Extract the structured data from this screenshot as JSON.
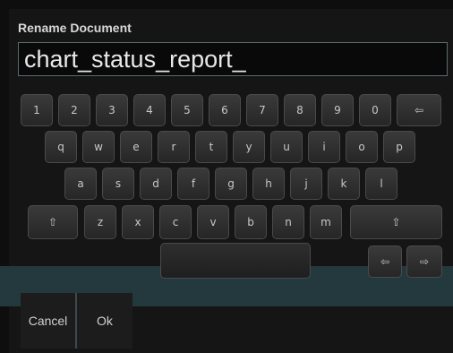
{
  "dialog": {
    "title": "Rename Document",
    "input_value": "chart_status_report_"
  },
  "keyboard": {
    "row1": [
      "1",
      "2",
      "3",
      "4",
      "5",
      "6",
      "7",
      "8",
      "9",
      "0",
      "⇦"
    ],
    "row2": [
      "q",
      "w",
      "e",
      "r",
      "t",
      "y",
      "u",
      "i",
      "o",
      "p"
    ],
    "row3": [
      "a",
      "s",
      "d",
      "f",
      "g",
      "h",
      "j",
      "k",
      "l"
    ],
    "row4": [
      "⇧",
      "z",
      "x",
      "c",
      "v",
      "b",
      "n",
      "m",
      "⇧"
    ],
    "arrows": [
      "⇦",
      "⇨"
    ]
  },
  "buttons": {
    "cancel": "Cancel",
    "ok": "Ok"
  }
}
